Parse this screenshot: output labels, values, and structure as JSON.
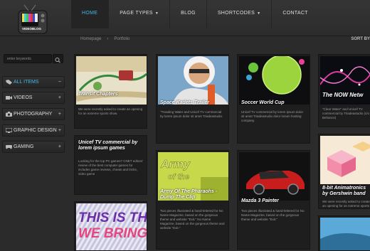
{
  "header": {
    "logo_text": "VIDEOBLOG",
    "nav": [
      {
        "label": "HOME",
        "active": true,
        "dropdown": false
      },
      {
        "label": "PAGE TYPES",
        "active": false,
        "dropdown": true
      },
      {
        "label": "BLOG",
        "active": false,
        "dropdown": false
      },
      {
        "label": "SHORTCODES",
        "active": false,
        "dropdown": true
      },
      {
        "label": "CONTACT",
        "active": false,
        "dropdown": false
      }
    ]
  },
  "breadcrumb": {
    "home": "Homepage",
    "current": "Portfolio"
  },
  "sort_label": "SORT BY",
  "search": {
    "placeholder": "enter keywords"
  },
  "categories": [
    {
      "label": "ALL ITEMS",
      "icon": "tag-icon",
      "mark": "−",
      "active": true
    },
    {
      "label": "VIDEOS",
      "icon": "video-icon",
      "mark": "+",
      "active": false
    },
    {
      "label": "PHOTOGRAPHY",
      "icon": "camera-icon",
      "mark": "+",
      "active": false
    },
    {
      "label": "GRAPHIC DESIGN",
      "icon": "monitor-icon",
      "mark": "+",
      "active": false
    },
    {
      "label": "GAMING",
      "icon": "gamepad-icon",
      "mark": "+",
      "active": false
    }
  ],
  "cards": [
    {
      "title": "Transit Chapters",
      "desc": "We were recently asked to create an opening for an extreme sports show."
    },
    {
      "title": "Unicef TV commercial by lorem ipsum games",
      "desc": "Looking for the top PC games? CNET editors' review of the best computer games for includes game reviews, cheats and tricks, video game"
    },
    {
      "title": "THIS IS THE WE BRING",
      "desc": ""
    },
    {
      "title": "Space Kadets Trailer",
      "desc": "\"Treading Water and Unicef TV commercial by lorem ipsum dolor sit amet Triadeastudio."
    },
    {
      "title": "Army Of The Pharaohs - Dump The Clip",
      "desc": "Two pieces illustrated & hand-lettered for No Name Magazine, based on the gorgeous theme and website \"Exit.\" No Name Magazine, based on the gorgeous theme and website \"Exit.\""
    },
    {
      "title": "Soccer World Cup",
      "desc": "Unicef TV commercial by lorem ipsum dolor sit amet Triadeastudio dolor lorium hosting company."
    },
    {
      "title": "Mazda 3 Painter",
      "desc": "Two pieces illustrated & hand-lettered for No Name Magazine, based on the gorgeous theme and website \"Exit.\""
    },
    {
      "title": "The NOW Netw",
      "desc": "\"Clear Water\" and Unicef TV commercial by Triadeastudio (c/o Behance)"
    },
    {
      "title": "8-bit Animatronics by Gershwin band",
      "desc": "We were recently asked to create an opening for an extreme sports show."
    }
  ],
  "colors": {
    "accent": "#45b7e8",
    "background": "#2b2b2c",
    "card": "#1e1e1f"
  }
}
